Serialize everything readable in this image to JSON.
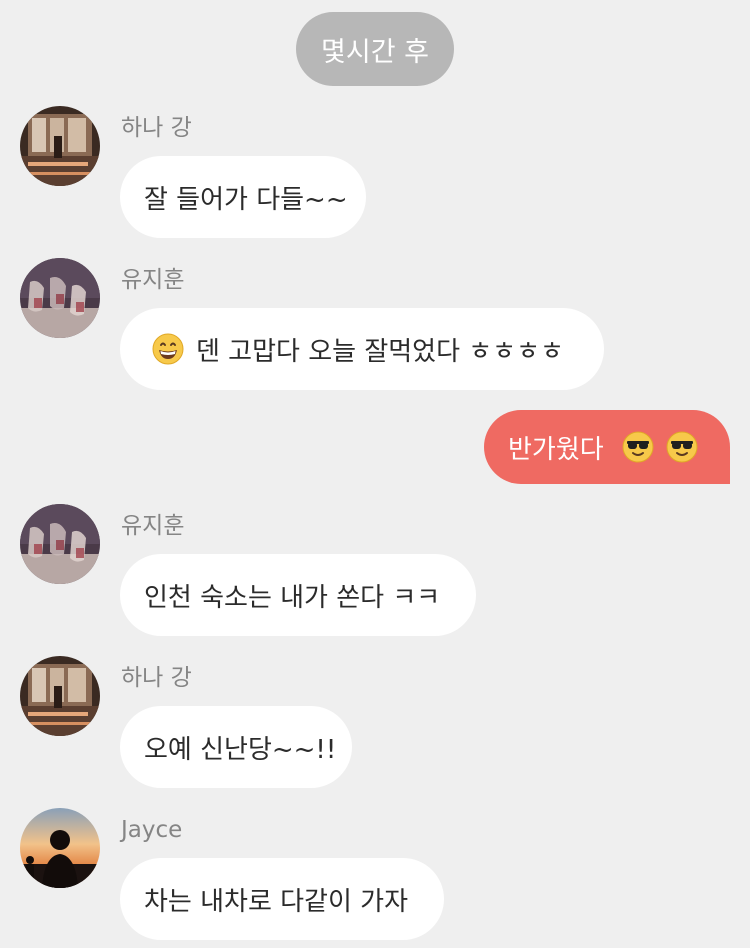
{
  "time_divider": "몇시간 후",
  "messages": [
    {
      "sender": "하나 강",
      "text": "잘 들어가 다들~~",
      "avatar": "avatar-window-room"
    },
    {
      "sender": "유지훈",
      "emoji": "grinning-face-icon",
      "text": "덴 고맙다 오늘 잘먹었다 ㅎㅎㅎㅎ",
      "avatar": "avatar-wine-glasses"
    },
    {
      "sender": "me",
      "text": "반가웠다",
      "emoji": "sunglasses-face-icon",
      "emoji_count": 2,
      "color": "#ef6a62"
    },
    {
      "sender": "유지훈",
      "text": "인천 숙소는 내가 쏜다 ㅋㅋ",
      "avatar": "avatar-wine-glasses"
    },
    {
      "sender": "하나 강",
      "text": "오예 신난당~~!!",
      "avatar": "avatar-window-room"
    },
    {
      "sender": "Jayce",
      "text": "차는 내차로 다같이 가자",
      "avatar": "avatar-sunset-silhouette"
    }
  ],
  "colors": {
    "background": "#efefef",
    "divider": "#b7b7b7",
    "incoming_bubble": "#ffffff",
    "outgoing_bubble": "#ef6a62",
    "sender_name": "#858585"
  }
}
